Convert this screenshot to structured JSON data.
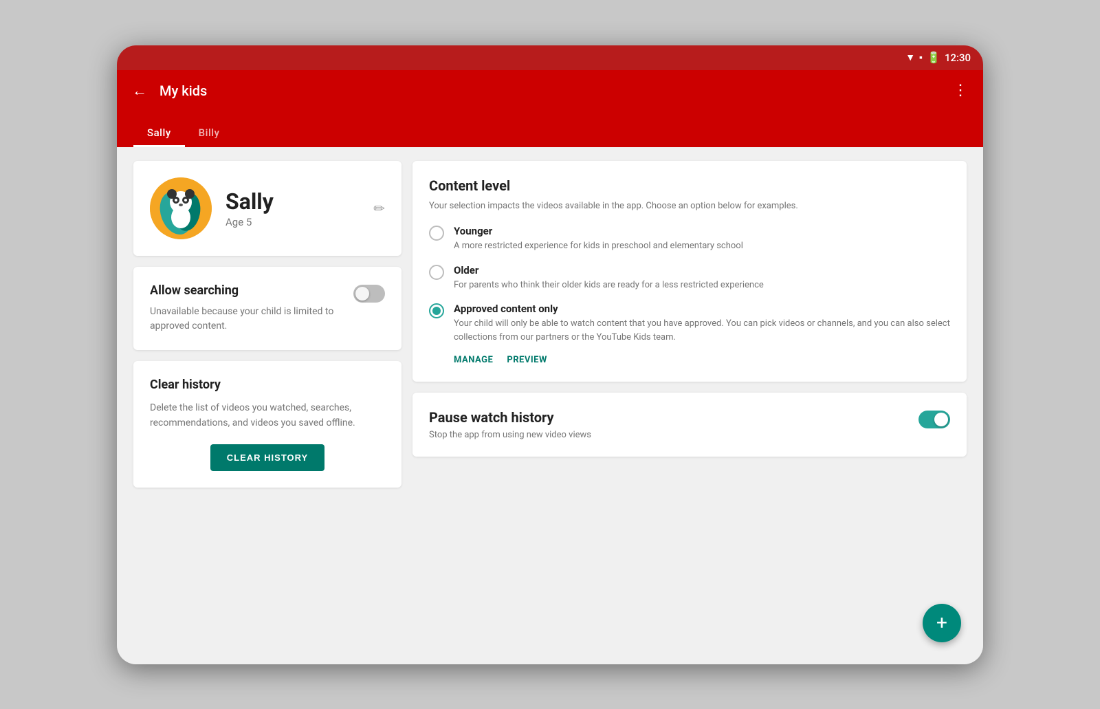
{
  "statusBar": {
    "time": "12:30"
  },
  "appBar": {
    "title": "My kids",
    "backIcon": "←",
    "moreIcon": "⋮"
  },
  "tabs": [
    {
      "label": "Sally",
      "active": true
    },
    {
      "label": "Billy",
      "active": false
    }
  ],
  "profile": {
    "name": "Sally",
    "age": "Age 5",
    "emoji": "🐼"
  },
  "allowSearching": {
    "title": "Allow searching",
    "description": "Unavailable because your child is limited to approved content."
  },
  "clearHistory": {
    "title": "Clear history",
    "description": "Delete the list of videos you watched, searches, recommendations, and videos you saved offline.",
    "buttonLabel": "CLEAR HISTORY"
  },
  "contentLevel": {
    "title": "Content level",
    "description": "Your selection impacts the videos available in the app. Choose an option below for examples.",
    "options": [
      {
        "label": "Younger",
        "description": "A more restricted experience for kids in preschool and elementary school",
        "selected": false
      },
      {
        "label": "Older",
        "description": "For parents who think their older kids are ready for a less restricted experience",
        "selected": false
      },
      {
        "label": "Approved content only",
        "description": "Your child will only be able to watch content that you have approved. You can pick videos or channels, and you can also select collections from our partners or the YouTube Kids team.",
        "selected": true
      }
    ],
    "manageLabel": "MANAGE",
    "previewLabel": "PREVIEW"
  },
  "pauseWatchHistory": {
    "title": "Pause watch history",
    "description": "Stop the app from using new video views",
    "toggleOn": true
  },
  "fab": {
    "icon": "+"
  }
}
